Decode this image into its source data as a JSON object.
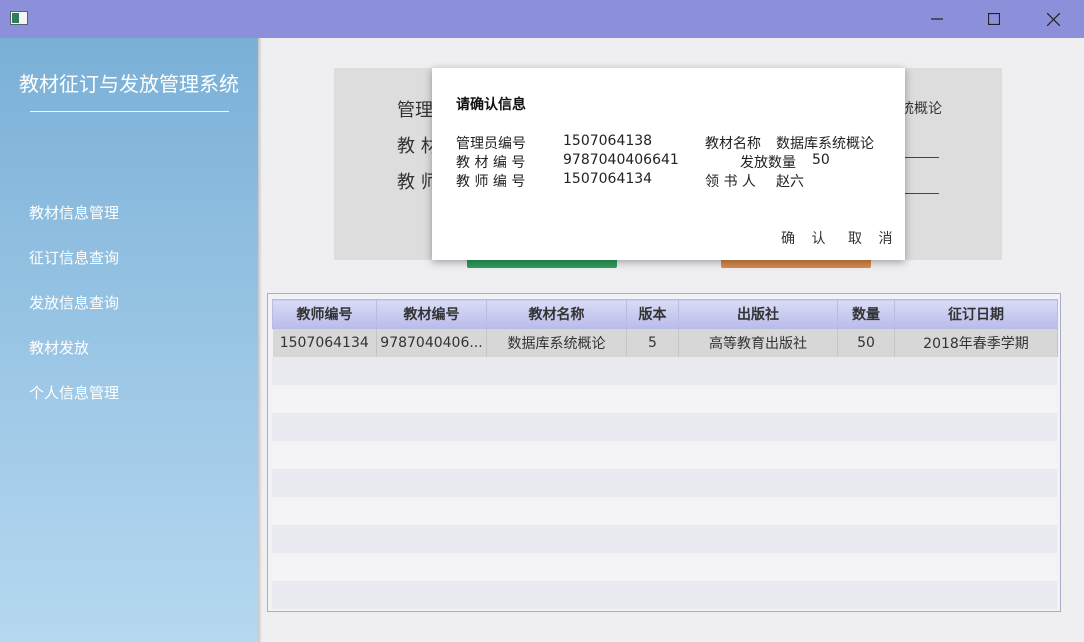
{
  "window": {
    "title": "",
    "controls": [
      "minimize-icon",
      "maximize-icon",
      "close-icon"
    ]
  },
  "sidebar": {
    "title": "教材征订与发放管理系统",
    "items": [
      {
        "label": "教材信息管理"
      },
      {
        "label": "征订信息查询"
      },
      {
        "label": "发放信息查询"
      },
      {
        "label": "教材发放"
      },
      {
        "label": "个人信息管理"
      }
    ]
  },
  "form": {
    "label_admin": "管理",
    "label_book": "教 材",
    "label_teacher": "教 师",
    "right_text": "统概论"
  },
  "table": {
    "columns": [
      "教师编号",
      "教材编号",
      "教材名称",
      "版本",
      "出版社",
      "数量",
      "征订日期"
    ],
    "rows": [
      [
        "1507064134",
        "9787040406...",
        "数据库系统概论",
        "5",
        "高等教育出版社",
        "50",
        "2018年春季学期"
      ]
    ]
  },
  "dialog": {
    "title": "请确认信息",
    "admin_id_label": "管理员编号",
    "admin_id": "1507064138",
    "book_name_label": "教材名称",
    "book_name": "数据库系统概论",
    "book_id_label": "教 材 编 号",
    "book_id": "9787040406641",
    "quantity_label": "发放数量",
    "quantity": "50",
    "teacher_id_label": "教 师 编 号",
    "teacher_id": "1507064134",
    "receiver_label": "领 书 人",
    "receiver": "赵六",
    "confirm": "确 认",
    "cancel": "取 消"
  },
  "colors": {
    "titlebar": "#8c8fd9",
    "sidebar_top": "#7ab0d6",
    "sidebar_bottom": "#b6d8f0",
    "confirm_button": "#2e9d5e",
    "cancel_button": "#d9894a"
  }
}
